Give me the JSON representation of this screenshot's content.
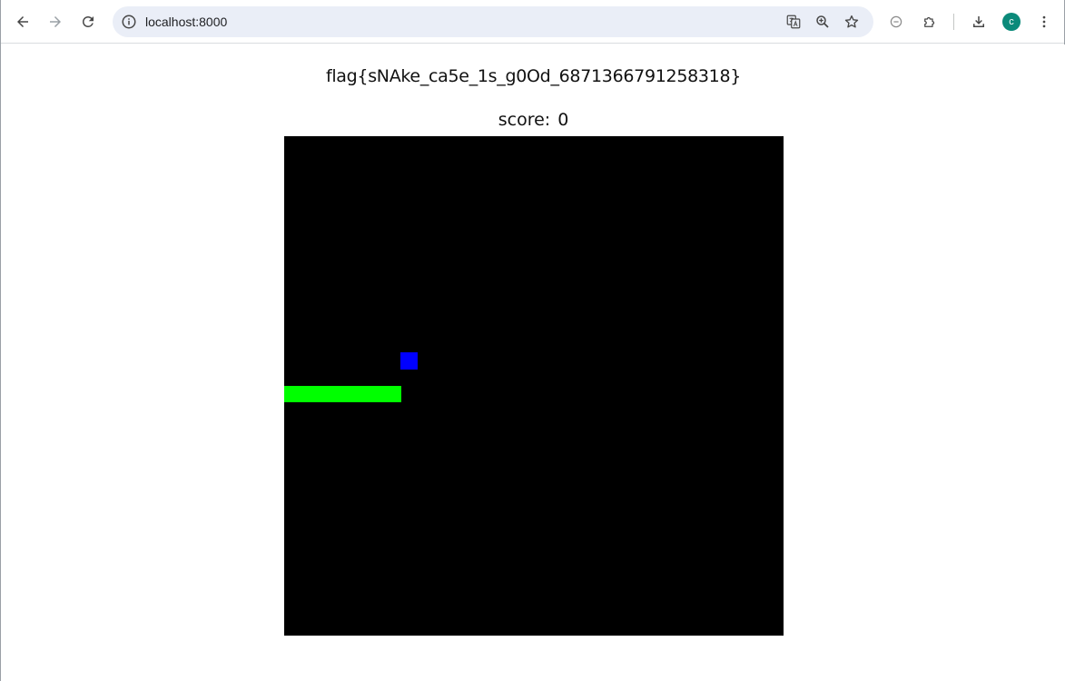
{
  "browser": {
    "url": "localhost:8000",
    "avatar_letter": "c",
    "icons": {
      "back": "arrow-left-icon",
      "forward": "arrow-right-icon",
      "reload": "reload-icon",
      "site_info": "info-icon",
      "translate": "translate-icon",
      "zoom": "zoom-in-icon",
      "bookmark": "star-icon",
      "media": "minus-circle-icon",
      "extensions": "puzzle-icon",
      "downloads": "download-icon",
      "menu": "kebab-menu-icon"
    }
  },
  "page": {
    "flag_text": "flag{sNAke_ca5e_1s_g0Od_6871366791258318}",
    "score_label": "score:",
    "score_value": "0"
  },
  "game": {
    "grid_size": 30,
    "colors": {
      "board": "#000000",
      "snake": "#00ff00",
      "food": "#0000ff"
    },
    "snake_cells": [
      [
        0,
        15
      ],
      [
        1,
        15
      ],
      [
        2,
        15
      ],
      [
        3,
        15
      ],
      [
        4,
        15
      ],
      [
        5,
        15
      ],
      [
        6,
        15
      ]
    ],
    "food_cell": [
      7,
      13
    ]
  }
}
